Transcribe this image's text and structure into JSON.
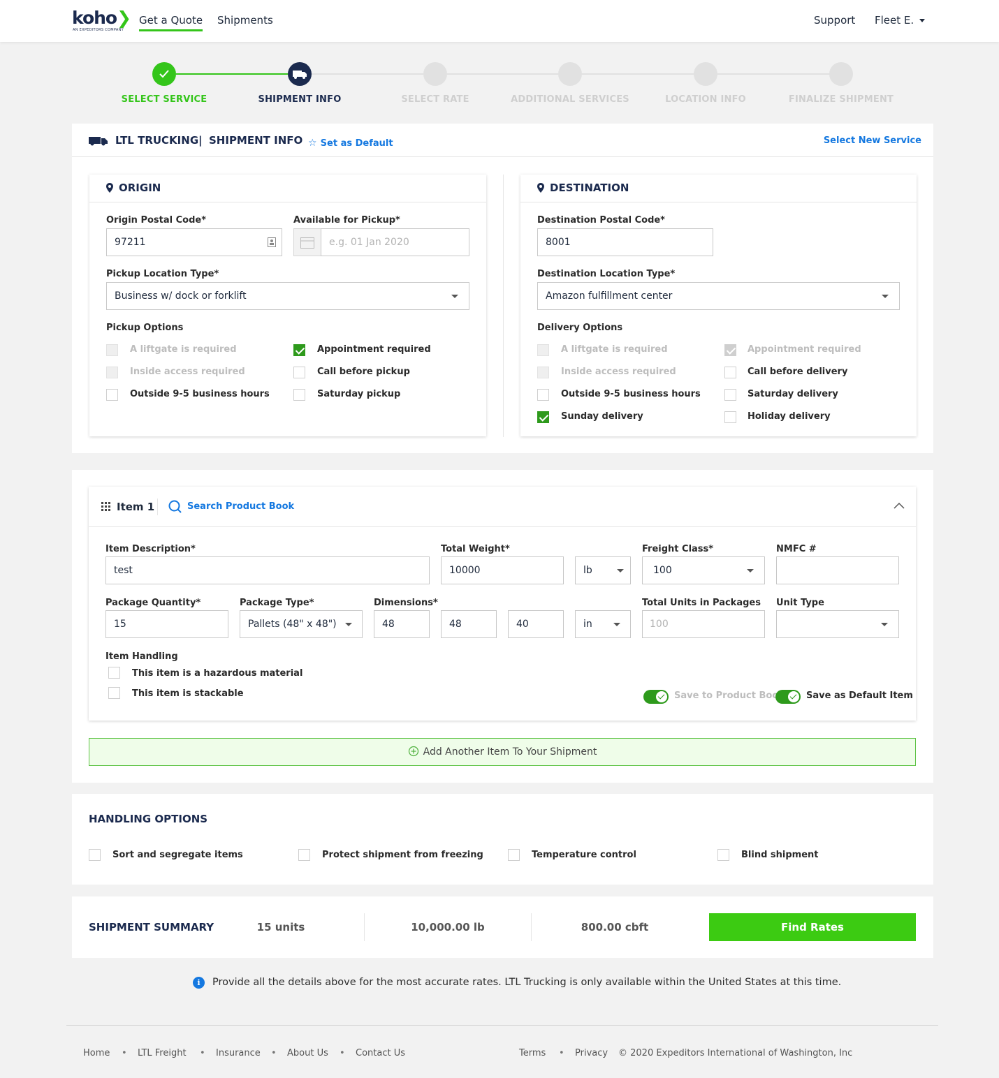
{
  "nav": {
    "logo_word": "koho",
    "logo_sub": "AN EXPEDITORS COMPANY",
    "links": [
      "Get a Quote",
      "Shipments"
    ],
    "support": "Support",
    "user": "Fleet E."
  },
  "stepper": {
    "steps": [
      "SELECT SERVICE",
      "SHIPMENT INFO",
      "SELECT RATE",
      "ADDITIONAL SERVICES",
      "LOCATION INFO",
      "FINALIZE SHIPMENT"
    ],
    "colors": {
      "done": "#34c51a",
      "current": "#1b2a4e",
      "todo": "#cfcfcf"
    }
  },
  "shipment_header": {
    "service": "LTL TRUCKING",
    "separator": "|",
    "section": "SHIPMENT INFO",
    "set_default": "Set as Default",
    "select_new": "Select New Service"
  },
  "origin": {
    "title": "ORIGIN",
    "postal_label": "Origin Postal Code*",
    "postal_value": "97211",
    "pickup_label": "Available for Pickup*",
    "pickup_placeholder": "e.g. 01 Jan 2020",
    "location_type_label": "Pickup Location Type*",
    "location_type_value": "Business w/ dock or forklift",
    "options_label": "Pickup Options",
    "options": [
      {
        "label": "A liftgate is required",
        "state": "disabled"
      },
      {
        "label": "Appointment required",
        "state": "checked"
      },
      {
        "label": "Inside access required",
        "state": "disabled"
      },
      {
        "label": "Call before pickup",
        "state": "unchecked"
      },
      {
        "label": "Outside 9-5 business hours",
        "state": "unchecked"
      },
      {
        "label": "Saturday pickup",
        "state": "unchecked"
      }
    ]
  },
  "destination": {
    "title": "DESTINATION",
    "postal_label": "Destination Postal Code*",
    "postal_value": "8001",
    "location_type_label": "Destination Location Type*",
    "location_type_value": "Amazon fulfillment center",
    "options_label": "Delivery Options",
    "options": [
      {
        "label": "A liftgate is required",
        "state": "disabled"
      },
      {
        "label": "Appointment required",
        "state": "checked-disabled"
      },
      {
        "label": "Inside access required",
        "state": "disabled"
      },
      {
        "label": "Call before delivery",
        "state": "unchecked"
      },
      {
        "label": "Outside 9-5 business hours",
        "state": "unchecked"
      },
      {
        "label": "Saturday delivery",
        "state": "unchecked"
      },
      {
        "label": "Sunday delivery",
        "state": "checked"
      },
      {
        "label": "Holiday delivery",
        "state": "unchecked"
      }
    ]
  },
  "item": {
    "title": "Item 1",
    "search": "Search Product Book",
    "description_label": "Item Description*",
    "description_value": "test",
    "weight_label": "Total Weight*",
    "weight_value": "10000",
    "weight_unit": "lb",
    "freight_label": "Freight Class*",
    "freight_value": "100",
    "nmfc_label": "NMFC #",
    "nmfc_value": "",
    "qty_label": "Package Quantity*",
    "qty_value": "15",
    "pkg_type_label": "Package Type*",
    "pkg_type_value": "Pallets (48\" x 48\")",
    "dims_label": "Dimensions*",
    "dims": [
      "48",
      "48",
      "40"
    ],
    "dims_unit": "in",
    "units_label": "Total Units in Packages",
    "units_placeholder": "100",
    "unit_type_label": "Unit Type",
    "unit_type_value": "",
    "handling_label": "Item Handling",
    "hazardous": "This item is a hazardous material",
    "stackable": "This item is stackable",
    "save_book": "Save to Product Book",
    "save_default": "Save as Default Item"
  },
  "add_item": "Add Another Item To Your Shipment",
  "handling": {
    "title": "HANDLING OPTIONS",
    "options": [
      "Sort and segregate items",
      "Protect shipment from freezing",
      "Temperature control",
      "Blind shipment"
    ]
  },
  "summary": {
    "title": "SHIPMENT SUMMARY",
    "units": "15 units",
    "weight": "10,000.00 lb",
    "volume": "800.00 cbft",
    "button": "Find Rates"
  },
  "info_note": "Provide all the details above for the most accurate rates. LTL Trucking is only available within the United States at this time.",
  "footer": {
    "links": [
      "Home",
      "LTL Freight",
      "Insurance",
      "About Us",
      "Contact Us"
    ],
    "legal": [
      "Terms",
      "Privacy"
    ],
    "copyright": "© 2020 Expeditors International of Washington, Inc"
  },
  "colors": {
    "accent_green": "#34c51a",
    "check_green": "#2e9a1c",
    "link_blue": "#1478e0",
    "navy": "#1b2a4e"
  }
}
